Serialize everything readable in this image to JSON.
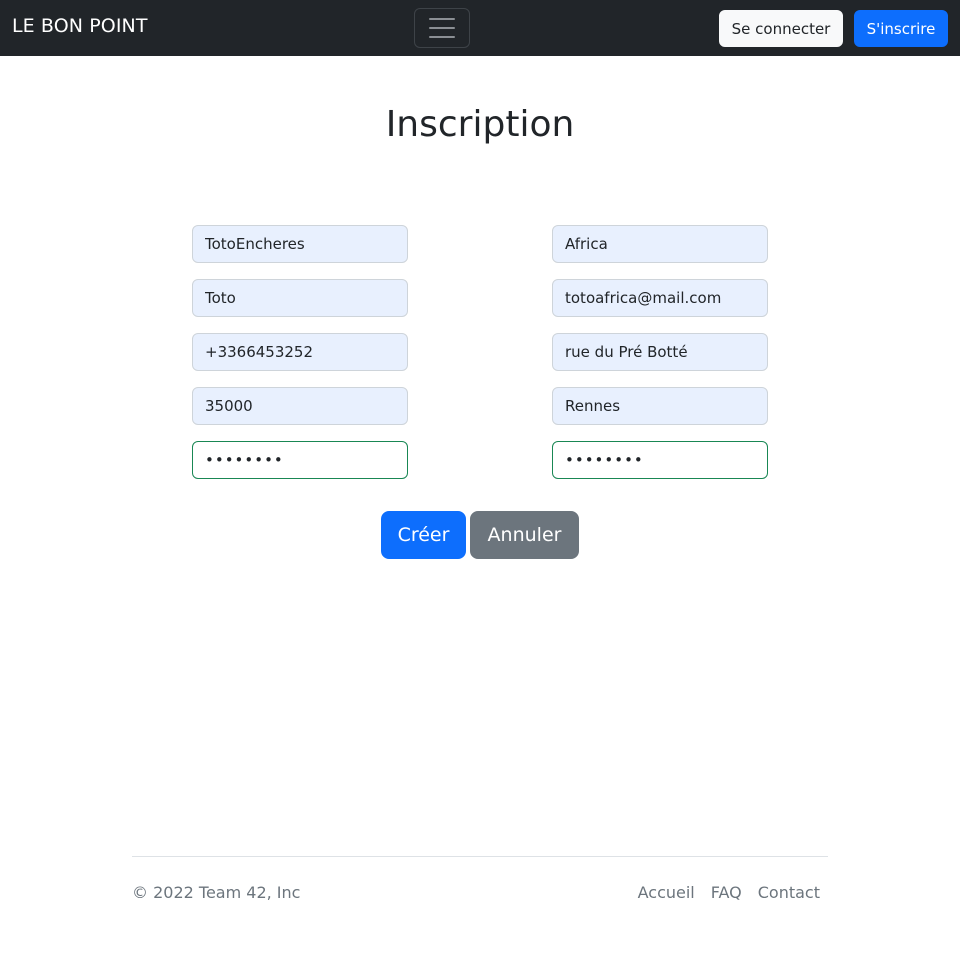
{
  "navbar": {
    "brand": "LE BON POINT",
    "toggler_icon": "hamburger-icon",
    "login_label": "Se connecter",
    "signup_label": "S'inscrire"
  },
  "title": "Inscription",
  "form": {
    "left": {
      "pseudo": "TotoEncheres",
      "prenom": "Toto",
      "telephone": "+3366453252",
      "code_postal": "35000",
      "password": "••••••••"
    },
    "right": {
      "nom": "Africa",
      "email": "totoafrica@mail.com",
      "rue": "rue du Pré Botté",
      "ville": "Rennes",
      "confirmation": "••••••••"
    }
  },
  "buttons": {
    "create": "Créer",
    "cancel": "Annuler"
  },
  "footer": {
    "copyright": "© 2022 Team 42, Inc",
    "links": [
      "Accueil",
      "FAQ",
      "Contact"
    ]
  },
  "colors": {
    "navbar_bg": "#212529",
    "primary": "#0d6efd",
    "secondary": "#6c757d",
    "valid_border": "#198754",
    "autofill_bg": "#e8f0fe"
  }
}
